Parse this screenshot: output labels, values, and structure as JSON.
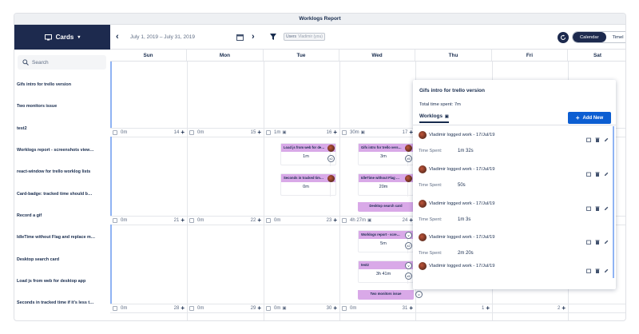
{
  "window": {
    "title": "Worklogs Report"
  },
  "sidebar": {
    "cards_label": "Cards",
    "search_placeholder": "Search",
    "items": [
      "Gifs intro for trello version",
      "Two monitors issue",
      "test2",
      "Worklogs report - screenshots view…",
      "react-window for trello worklog lists",
      "Card-badge: tracked time should b…",
      "Record a gif",
      "IdleTime without Flag and replace m…",
      "Desktop search card",
      "Load js from web for desktop app",
      "Seconds in tracked time if it's less t…"
    ]
  },
  "toolbar": {
    "date_range": "July 1, 2019 – July 31, 2019",
    "filter_label": "Users",
    "filter_value": "Vladimir (you)",
    "view_calendar": "Calendar",
    "view_timeline": "Timel"
  },
  "days": [
    "Sun",
    "Mon",
    "Tue",
    "Wed",
    "Thu",
    "Fri",
    "Sat"
  ],
  "weeks": [
    {
      "cells": [
        {
          "time": "0m",
          "num": "14"
        },
        {
          "time": "0m",
          "num": "15"
        },
        {
          "time": "1m",
          "num": "16",
          "clip": true
        },
        {
          "time": "30m",
          "num": "17",
          "clip": true
        }
      ]
    },
    {
      "cells": [
        {
          "time": "0m",
          "num": "21"
        },
        {
          "time": "0m",
          "num": "22"
        },
        {
          "time": "0m",
          "num": "23"
        },
        {
          "time": "4h 27m",
          "num": "24",
          "clip": true
        }
      ]
    },
    {
      "cells": [
        {
          "time": "0m",
          "num": "28"
        },
        {
          "time": "0m",
          "num": "29"
        },
        {
          "time": "0m",
          "num": "30",
          "clip": true
        },
        {
          "time": "0m",
          "num": "31"
        },
        {
          "time": "",
          "num": "1"
        },
        {
          "time": "",
          "num": "2"
        }
      ]
    }
  ],
  "cards": {
    "tue_1": {
      "title": "Load js from web for de…",
      "time": "1m",
      "badge": "x2"
    },
    "tue_2": {
      "title": "Seconds in tracked tim…",
      "time": "0m"
    },
    "wed_1": {
      "title": "Gifs intro for trello vers…",
      "time": "3m",
      "badge": "x5"
    },
    "wed_2": {
      "title": "IdleTime without Flag …",
      "time": "20m"
    },
    "wed_3": {
      "title": "Desktop search card"
    },
    "wed_4": {
      "title": "Worklogs report - scre…",
      "time": "5m",
      "badge": "x2"
    },
    "wed_5": {
      "title": "test2",
      "time": "3h 41m",
      "badge": "x5"
    },
    "wed_6": {
      "title": "Two monitors issue"
    }
  },
  "popup": {
    "title": "Gifs intro for trello version",
    "total": "Total time spent: 7m",
    "tab_label": "Worklogs",
    "add_new": "Add New",
    "time_spent_label": "Time Spent:",
    "entries": [
      {
        "user": "Vladimir logged work - 17/Jul/19",
        "value": "1m 32s"
      },
      {
        "user": "Vladimir logged work - 17/Jul/19",
        "value": "50s"
      },
      {
        "user": "Vladimir logged work - 17/Jul/19",
        "value": "1m 3s"
      },
      {
        "user": "Vladimir logged work - 17/Jul/19",
        "value": "2m 20s"
      },
      {
        "user": "Vladimir logged work - 17/Jul/19",
        "value": ""
      }
    ]
  },
  "colors": {
    "navy": "#1d2a4e",
    "card_purple": "#d9a9e8",
    "primary_blue": "#0c5ed2"
  }
}
